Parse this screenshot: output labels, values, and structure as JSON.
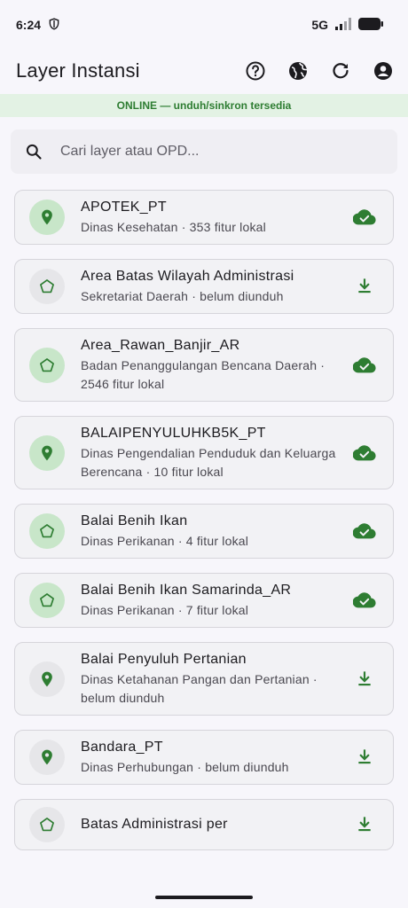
{
  "status": {
    "time": "6:24",
    "network": "5G"
  },
  "app": {
    "title": "Layer Instansi"
  },
  "banner": {
    "text": "ONLINE — unduh/sinkron tersedia"
  },
  "search": {
    "placeholder": "Cari layer atau OPD..."
  },
  "layers": [
    {
      "title": "APOTEK_PT",
      "subtitle": "Dinas Kesehatan · 353 fitur lokal",
      "geometry": "point",
      "state": "downloaded"
    },
    {
      "title": "Area Batas Wilayah Administrasi",
      "subtitle": "Sekretariat Daerah · belum diunduh",
      "geometry": "polygon",
      "state": "pending"
    },
    {
      "title": "Area_Rawan_Banjir_AR",
      "subtitle": "Badan Penanggulangan Bencana Daerah · 2546 fitur lokal",
      "geometry": "polygon",
      "state": "downloaded"
    },
    {
      "title": "BALAIPENYULUHKB5K_PT",
      "subtitle": "Dinas Pengendalian Penduduk dan Keluarga Berencana · 10 fitur lokal",
      "geometry": "point",
      "state": "downloaded"
    },
    {
      "title": "Balai Benih Ikan",
      "subtitle": "Dinas Perikanan · 4 fitur lokal",
      "geometry": "polygon",
      "state": "downloaded"
    },
    {
      "title": "Balai Benih Ikan Samarinda_AR",
      "subtitle": "Dinas Perikanan · 7 fitur lokal",
      "geometry": "polygon",
      "state": "downloaded"
    },
    {
      "title": "Balai Penyuluh Pertanian",
      "subtitle": "Dinas Ketahanan Pangan dan Pertanian · belum diunduh",
      "geometry": "point",
      "state": "pending"
    },
    {
      "title": "Bandara_PT",
      "subtitle": "Dinas Perhubungan · belum diunduh",
      "geometry": "point",
      "state": "pending"
    },
    {
      "title": "Batas Administrasi per",
      "subtitle": "",
      "geometry": "polygon",
      "state": "pending"
    }
  ],
  "colors": {
    "accent": "#2e7d32",
    "banner_bg": "#e3f2e4"
  }
}
